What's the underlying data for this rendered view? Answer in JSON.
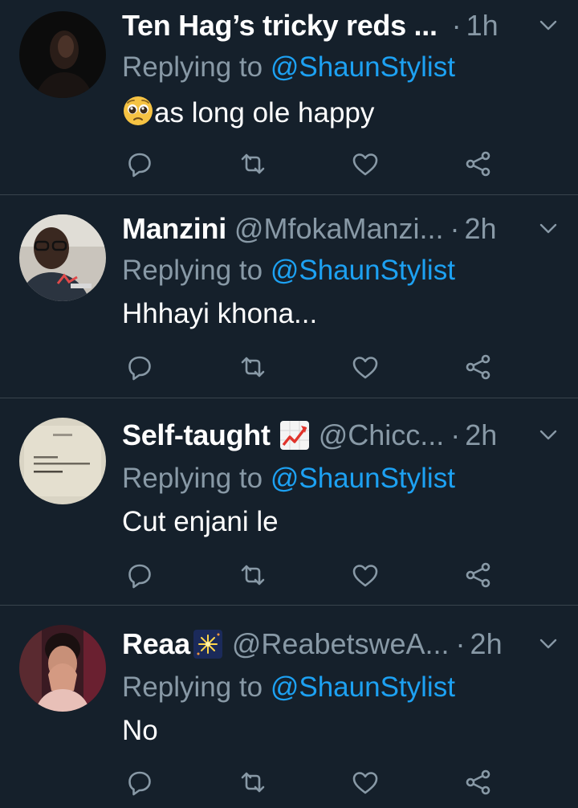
{
  "colors": {
    "background": "#15202b",
    "divider": "#38444d",
    "muted": "#8899a6",
    "link": "#1da1f2",
    "text": "#ffffff"
  },
  "reply_prefix": "Replying to",
  "tweets": [
    {
      "name": "Ten Hag’s tricky reds ...",
      "handle": "",
      "time": "1h",
      "reply_to": "@ShaunStylist",
      "text": "as long ole happy",
      "text_emoji": "pleading-face-emoji",
      "avatar": "dark-portrait-avatar"
    },
    {
      "name": "Manzini",
      "handle": "@MfokaManzi...",
      "time": "2h",
      "reply_to": "@ShaunStylist",
      "text": "Hhhayi khona...",
      "avatar": "man-glasses-avatar"
    },
    {
      "name": "Self-taught",
      "name_emoji": "chart-increasing-emoji",
      "handle": "@Chicc...",
      "time": "2h",
      "reply_to": "@ShaunStylist",
      "text": "Cut enjani le",
      "avatar": "book-page-avatar"
    },
    {
      "name": "Reaa",
      "name_emoji": "fireworks-emoji",
      "handle": "@ReabetsweA...",
      "time": "2h",
      "reply_to": "@ShaunStylist",
      "text": "No",
      "avatar": "woman-hands-face-avatar"
    }
  ],
  "icons": {
    "dot": "·",
    "reply": "reply-icon",
    "retweet": "retweet-icon",
    "like": "heart-icon",
    "share": "share-icon",
    "menu": "chevron-down-icon"
  }
}
